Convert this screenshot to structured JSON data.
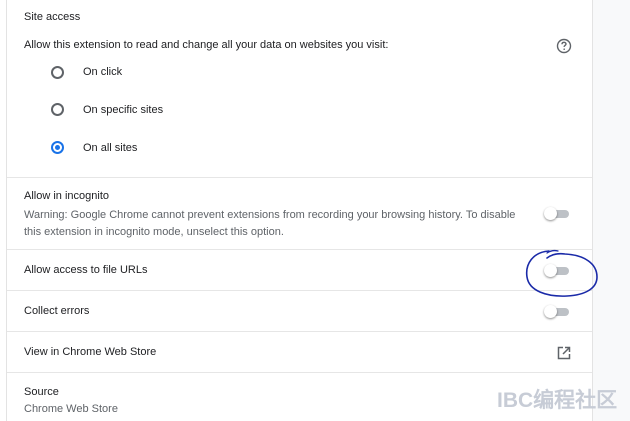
{
  "site_access": {
    "title": "Site access",
    "question": "Allow this extension to read and change all your data on websites you visit:",
    "help_icon": "help-circle-icon",
    "options": [
      {
        "label": "On click",
        "checked": false
      },
      {
        "label": "On specific sites",
        "checked": false
      },
      {
        "label": "On all sites",
        "checked": true
      }
    ]
  },
  "incognito": {
    "label": "Allow in incognito",
    "warning": "Warning: Google Chrome cannot prevent extensions from recording your browsing history. To disable this extension in incognito mode, unselect this option.",
    "enabled": false
  },
  "file_urls": {
    "label": "Allow access to file URLs",
    "enabled": false
  },
  "collect_errors": {
    "label": "Collect errors",
    "enabled": false
  },
  "web_store": {
    "label": "View in Chrome Web Store",
    "icon": "open-in-new-icon"
  },
  "source": {
    "label": "Source",
    "value": "Chrome Web Store"
  },
  "watermark": "IBC编程社区",
  "colors": {
    "accent": "#1a73e8",
    "annotation": "#1a2aa8",
    "toggle_off": "#bdc1c6"
  }
}
